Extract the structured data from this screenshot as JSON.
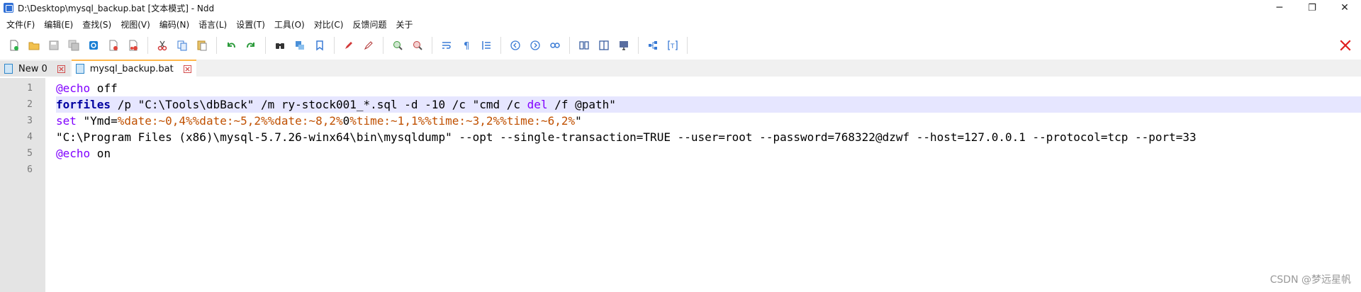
{
  "window": {
    "title": "D:\\Desktop\\mysql_backup.bat [文本模式] - Ndd",
    "controls": {
      "minimize": "─",
      "maximize": "❐",
      "close": "✕"
    }
  },
  "menu": [
    {
      "id": "file",
      "label": "文件(F)"
    },
    {
      "id": "edit",
      "label": "编辑(E)"
    },
    {
      "id": "find",
      "label": "查找(S)"
    },
    {
      "id": "view",
      "label": "视图(V)"
    },
    {
      "id": "encoding",
      "label": "编码(N)"
    },
    {
      "id": "language",
      "label": "语言(L)"
    },
    {
      "id": "settings",
      "label": "设置(T)"
    },
    {
      "id": "tools",
      "label": "工具(O)"
    },
    {
      "id": "compare",
      "label": "对比(C)"
    },
    {
      "id": "feedback",
      "label": "反馈问题"
    },
    {
      "id": "about",
      "label": "关于"
    }
  ],
  "tabs": [
    {
      "label": "New 0",
      "active": false
    },
    {
      "label": "mysql_backup.bat",
      "active": true
    }
  ],
  "editor": {
    "line_numbers": [
      "1",
      "2",
      "3",
      "4",
      "5",
      "6"
    ],
    "current_line": 2,
    "lines": {
      "l1_at": "@",
      "l1_kw": "echo",
      "l1_rest": " off",
      "l2_kw": "forfiles",
      "l2_a": " /p \"C:\\Tools\\dbBack\" /m ry-stock001_*.sql -d -10 /c \"cmd /c ",
      "l2_del": "del",
      "l2_b": " /f @path\"",
      "l3_kw": "set",
      "l3_a": " \"Ymd=",
      "l3_v1": "%date:~0,4%",
      "l3_v2": "%date:~5,2%",
      "l3_v3": "%date:~8,2%",
      "l3_0": "0",
      "l3_v4": "%time:~1,1%",
      "l3_v5": "%time:~3,2%",
      "l3_v6": "%time:~6,2%",
      "l3_end": "\"",
      "l4": "\"C:\\Program Files (x86)\\mysql-5.7.26-winx64\\bin\\mysqldump\" --opt --single-transaction=TRUE --user=root --password=768322@dzwf --host=127.0.0.1 --protocol=tcp --port=33",
      "l5_at": "@",
      "l5_kw": "echo",
      "l5_rest": " on"
    }
  },
  "watermark": "CSDN @梦远星帆",
  "colors": {
    "keyword": "#8000ff",
    "builtin": "#0000a0",
    "variable": "#c05000",
    "current_line": "#e6e6ff",
    "gutter": "#e4e4e4",
    "close_red": "#e02020",
    "active_tab_accent": "#ffb74a"
  }
}
